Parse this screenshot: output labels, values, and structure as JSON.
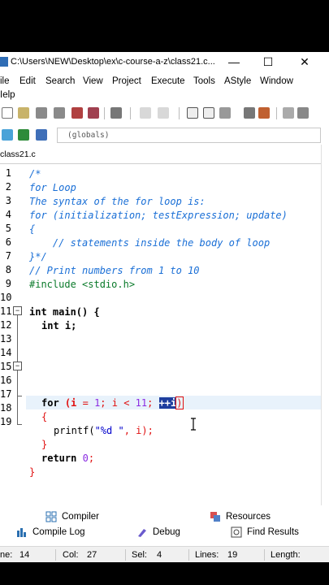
{
  "window": {
    "title": "C:\\Users\\NEW\\Desktop\\ex\\c-course-a-z\\class21.c...",
    "minimize": "—",
    "maximize": "☐",
    "close": "✕"
  },
  "menu": {
    "file": "ile",
    "edit": "Edit",
    "search": "Search",
    "view": "View",
    "project": "Project",
    "execute": "Execute",
    "tools": "Tools",
    "astyle": "AStyle",
    "window": "Window",
    "help": "Ielp"
  },
  "toolbar2": {
    "globals": "(globals)"
  },
  "tab": {
    "label": "class21.c"
  },
  "editor": {
    "line_numbers": [
      "1",
      "2",
      "3",
      "4",
      "5",
      "6",
      "7",
      "8",
      "9",
      "10",
      "11",
      "12",
      "13",
      "14",
      "15",
      "16",
      "17",
      "18",
      "19"
    ],
    "fold_markers": {
      "l11": "−",
      "l15": "−"
    },
    "code": {
      "l1": "/*",
      "l2": "for Loop",
      "l3": "The syntax of the for loop is:",
      "l4": "for (initialization; testExpression; update)",
      "l5": "{",
      "l6": "    // statements inside the body of loop",
      "l7": "}*/",
      "l8": "// Print numbers from 1 to 10",
      "l9": "#include <stdio.h>",
      "l11_kw": "int",
      "l11_rest": " main() {",
      "l12_kw": "int",
      "l12_rest": " i;",
      "l14_kw": "for",
      "l14_a": " (i ",
      "l14_eq": "=",
      "l14_b": " ",
      "l14_n1": "1",
      "l14_c": "; i ",
      "l14_lt": "<",
      "l14_d": " ",
      "l14_n2": "11",
      "l14_e": "; ",
      "l14_sel": "++i",
      "l14_close": ")",
      "l15": "{",
      "l16_a": "printf(",
      "l16_str": "\"%d \"",
      "l16_b": ", i);",
      "l17": "}",
      "l18_kw": "return",
      "l18_sp": " ",
      "l18_num": "0",
      "l18_end": ";",
      "l19": "}"
    }
  },
  "bottom": {
    "compiler": "Compiler",
    "resources": "Resources",
    "compile_log": "Compile Log",
    "debug": "Debug",
    "find_results": "Find Results"
  },
  "status": {
    "line_label": "ne:",
    "line_value": "14",
    "col_label": "Col:",
    "col_value": "27",
    "sel_label": "Sel:",
    "sel_value": "4",
    "lines_label": "Lines:",
    "lines_value": "19",
    "length_label": "Length:"
  },
  "colors": {
    "comment": "#1a6fd6",
    "preprocessor": "#0a7a2a",
    "number": "#8a2be2",
    "string": "#0000cc",
    "selection": "#1e3e9e",
    "current_line": "#e8f2fb"
  }
}
